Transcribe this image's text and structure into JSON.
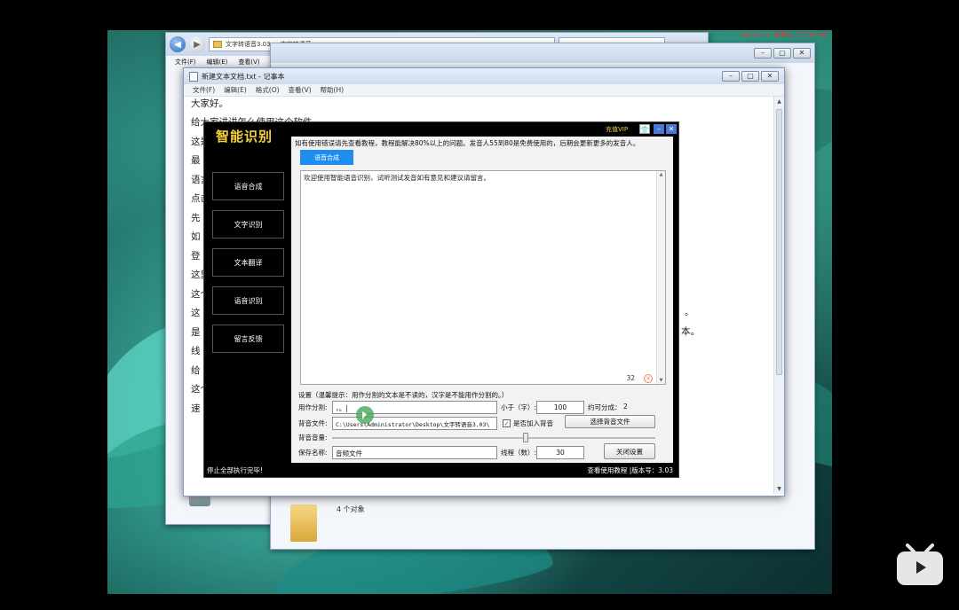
{
  "desktop": {
    "clock_text": "2021/1/1 星期五 15:50:00"
  },
  "explorer": {
    "address": "文字转语音3.03 ... 文字转语音",
    "menu": [
      "文件(F)",
      "编辑(E)",
      "查看(V)"
    ],
    "status": "4 个对象"
  },
  "notepad": {
    "title": "新建文本文档.txt - 记事本",
    "menu": [
      "文件(F)",
      "编辑(E)",
      "格式(O)",
      "查看(V)",
      "帮助(H)"
    ],
    "lines": [
      "大家好。",
      "给大家讲讲怎么使用这个软件",
      "这是",
      "最",
      "语言",
      "点击",
      "先",
      "如",
      "登",
      "这里",
      "这个",
      "这",
      "是",
      "线",
      "给",
      "这个",
      "速"
    ],
    "right_marks": [
      "。",
      "本。"
    ]
  },
  "app": {
    "title": "智能识别",
    "vip": "充值VIP",
    "controls": {
      "shirt": "👕",
      "min": "–",
      "close": "✕"
    },
    "sidebar": [
      "语音合成",
      "文字识别",
      "文本翻译",
      "语音识别",
      "留言反馈"
    ],
    "notice": "如有使用错误请先查看教程，教程能解决80%以上的问题。发音人55到80是免费使用的，后期会更新更多的发音人。",
    "active_tab": "语音合成",
    "textarea_text": "欢迎使用智能语音识别，试听测试发音如有意见和建议请留言。",
    "char_count": "32",
    "settings": {
      "heading": "设置（温馨提示：用作分割的文本是不读的，汉字是不能用作分割的。）",
      "split_label": "用作分割:",
      "split_value": "，。|",
      "less_than_label": "小于（字）:",
      "less_than_value": "100",
      "segments_label": "约可分成：",
      "segments_value": "2",
      "bg_file_label": "背音文件:",
      "bg_file_value": "C:\\Users\\Administrator\\Desktop\\文字转语音3.03\\",
      "add_bg_label": "是否加入背音",
      "add_bg_checked": true,
      "choose_bg_button": "选择背音文件",
      "bg_volume_label": "背音音量:",
      "bg_volume": 0.6,
      "save_name_label": "保存名称:",
      "save_name_value": "音频文件",
      "threads_label": "线程（数）:",
      "threads_value": "30",
      "close_settings_button": "关闭设置"
    },
    "status_left": "停止全部执行完毕!",
    "status_right": "查看使用教程 |版本号：3.03"
  }
}
